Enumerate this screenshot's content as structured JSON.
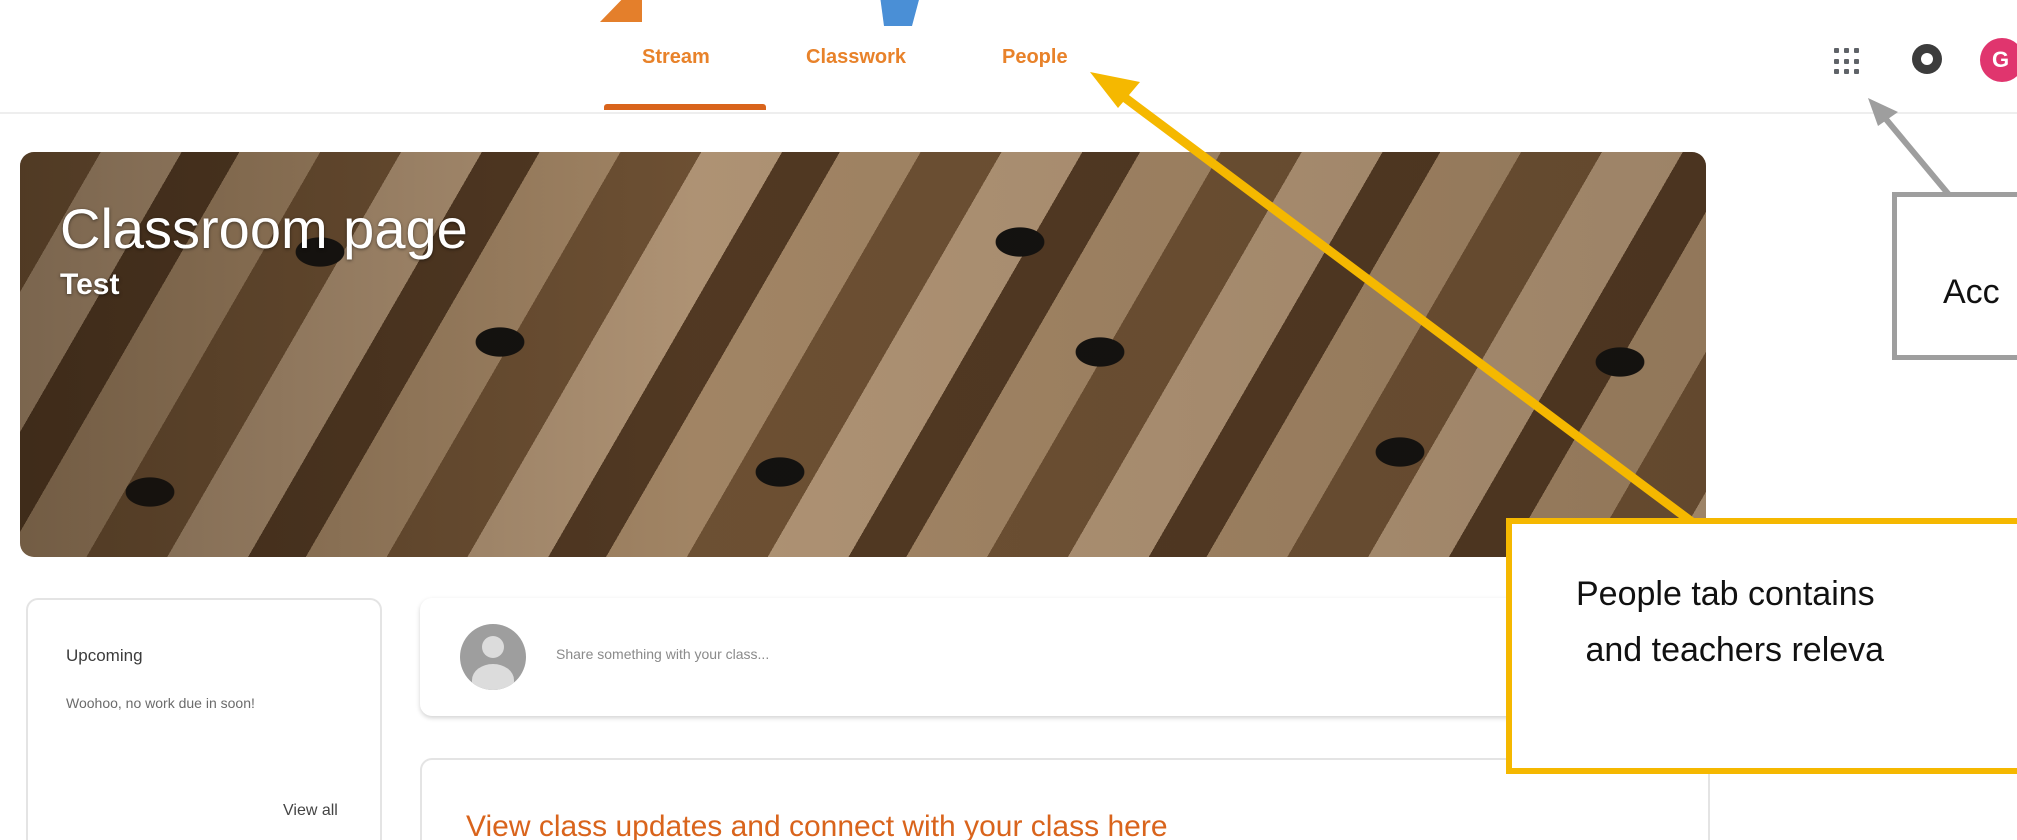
{
  "tabs": [
    {
      "label": "Stream",
      "active": true
    },
    {
      "label": "Classwork",
      "active": false
    },
    {
      "label": "People",
      "active": false
    }
  ],
  "header": {
    "avatar_letter": "G",
    "icons": [
      "apps-grid-icon",
      "settings-icon",
      "account-avatar"
    ]
  },
  "banner": {
    "title": "Classroom page",
    "subtitle": "Test"
  },
  "upcoming": {
    "title": "Upcoming",
    "text": "Woohoo, no work due in soon!",
    "view_all": "View all"
  },
  "share": {
    "placeholder": "Share something with your class..."
  },
  "updates": {
    "text": "View class updates and connect with your class here"
  },
  "annotations": {
    "gray_callout": "Acc",
    "yellow_callout": "People tab contains\n and teachers releva"
  },
  "colors": {
    "accent": "#d9641c",
    "tab_text": "#e8822a",
    "arrow_yellow": "#f5b800",
    "arrow_gray": "#9e9e9e"
  }
}
